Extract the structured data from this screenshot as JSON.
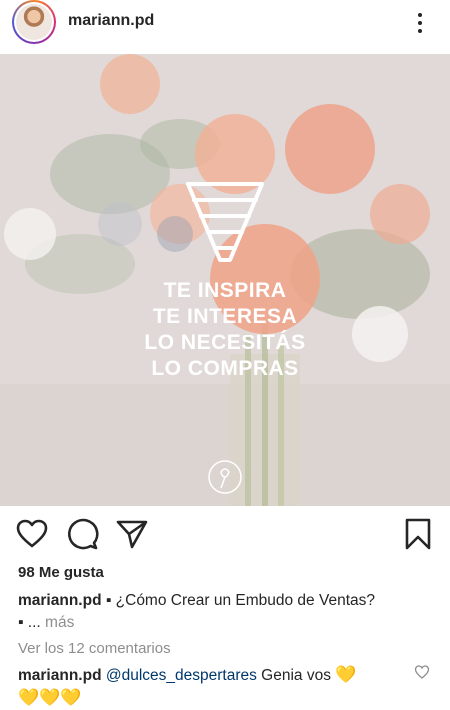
{
  "header": {
    "username": "mariann.pd",
    "more_icon": "more-vertical-icon"
  },
  "post": {
    "overlay_lines": [
      "TE INSPIRA",
      "TE INTERESA",
      "LO NECESITÁS",
      "LO COMPRAS"
    ],
    "funnel_icon": "funnel-icon",
    "logo_icon": "rose-logo-icon"
  },
  "actions": {
    "like_icon": "heart-icon",
    "comment_icon": "comment-icon",
    "share_icon": "send-icon",
    "save_icon": "bookmark-icon"
  },
  "likes": "98 Me gusta",
  "caption": {
    "username": "mariann.pd",
    "text": " ▪ ¿Cómo Crear un Embudo de Ventas?",
    "line2": "▪ ... ",
    "more": "más"
  },
  "comments_link": "Ver los 12 comentarios",
  "comment": {
    "username": "mariann.pd",
    "mention": "@dulces_despertares",
    "text": " Genia vos ",
    "emojis_inline": "💛",
    "emojis_line2": "💛💛💛"
  },
  "colors": {
    "text": "#262626",
    "muted": "#8e8e8e",
    "mention": "#00376b"
  }
}
